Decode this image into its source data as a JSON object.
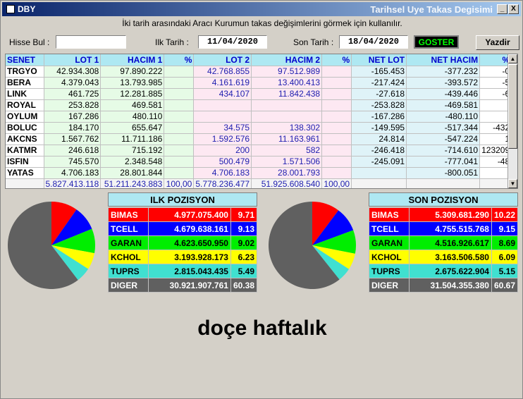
{
  "window": {
    "title": "DBY",
    "subtitle": "Tarihsel Uye Takas Degisimi",
    "min_label": "_",
    "close_label": "X"
  },
  "info_text": "İki tarih arasındaki Aracı Kurumun takas değişimlerini görmek için kullanılır.",
  "controls": {
    "hisse_label": "Hisse Bul :",
    "hisse_value": "",
    "ilk_label": "Ilk Tarih :",
    "ilk_value": "11/04/2020",
    "son_label": "Son Tarih :",
    "son_value": "18/04/2020",
    "goster_label": "GOSTER",
    "yazdir_label": "Yazdir"
  },
  "table": {
    "headers": [
      "SENET",
      "LOT 1",
      "HACIM 1",
      "%",
      "LOT 2",
      "HACIM 2",
      "%",
      "NET LOT",
      "NET HACIM",
      "%"
    ],
    "rows": [
      [
        "TRGYO",
        "42.934.308",
        "97.890.222",
        "",
        "42.768.855",
        "97.512.989",
        "",
        "-165.453",
        "-377.232",
        "-0"
      ],
      [
        "BERA",
        "4.379.043",
        "13.793.985",
        "",
        "4.161.619",
        "13.400.413",
        "",
        "-217.424",
        "-393.572",
        "-5"
      ],
      [
        "LINK",
        "461.725",
        "12.281.885",
        "",
        "434.107",
        "11.842.438",
        "",
        "-27.618",
        "-439.446",
        "-6"
      ],
      [
        "ROYAL",
        "253.828",
        "469.581",
        "",
        "",
        "",
        "",
        "-253.828",
        "-469.581",
        ""
      ],
      [
        "OYLUM",
        "167.286",
        "480.110",
        "",
        "",
        "",
        "",
        "-167.286",
        "-480.110",
        ""
      ],
      [
        "BOLUC",
        "184.170",
        "655.647",
        "",
        "34.575",
        "138.302",
        "",
        "-149.595",
        "-517.344",
        "-432"
      ],
      [
        "AKCNS",
        "1.567.762",
        "11.711.186",
        "",
        "1.592.576",
        "11.163.961",
        "",
        "24.814",
        "-547.224",
        "1"
      ],
      [
        "KATMR",
        "246.618",
        "715.192",
        "",
        "200",
        "582",
        "",
        "-246.418",
        "-714.610",
        "123209"
      ],
      [
        "ISFIN",
        "745.570",
        "2.348.548",
        "",
        "500.479",
        "1.571.506",
        "",
        "-245.091",
        "-777.041",
        "-48"
      ],
      [
        "YATAS",
        "4.706.183",
        "28.801.844",
        "",
        "4.706.183",
        "28.001.793",
        "",
        "",
        "-800.051",
        ""
      ]
    ],
    "totals": [
      "",
      "5.827.413.118",
      "51.211.243.883",
      "100,00",
      "5.778.236.477",
      "51.925.608.540",
      "100,00",
      "",
      "",
      ""
    ]
  },
  "ilk_pozisyon": {
    "title": "ILK POZISYON",
    "rows": [
      {
        "name": "BIMAS",
        "value": "4.977.075.400",
        "pct": "9.71",
        "color": "#ff0000",
        "text": "#ffffff"
      },
      {
        "name": "TCELL",
        "value": "4.679.638.161",
        "pct": "9.13",
        "color": "#0000ff",
        "text": "#ffffff"
      },
      {
        "name": "GARAN",
        "value": "4.623.650.950",
        "pct": "9.02",
        "color": "#00ee00",
        "text": "#000000"
      },
      {
        "name": "KCHOL",
        "value": "3.193.928.173",
        "pct": "6.23",
        "color": "#ffff00",
        "text": "#000000"
      },
      {
        "name": "TUPRS",
        "value": "2.815.043.435",
        "pct": "5.49",
        "color": "#40e0d0",
        "text": "#000000"
      },
      {
        "name": "DIGER",
        "value": "30.921.907.761",
        "pct": "60.38",
        "color": "#606060",
        "text": "#ffffff"
      }
    ]
  },
  "son_pozisyon": {
    "title": "SON POZISYON",
    "rows": [
      {
        "name": "BIMAS",
        "value": "5.309.681.290",
        "pct": "10.22",
        "color": "#ff0000",
        "text": "#ffffff"
      },
      {
        "name": "TCELL",
        "value": "4.755.515.768",
        "pct": "9.15",
        "color": "#0000ff",
        "text": "#ffffff"
      },
      {
        "name": "GARAN",
        "value": "4.516.926.617",
        "pct": "8.69",
        "color": "#00ee00",
        "text": "#000000"
      },
      {
        "name": "KCHOL",
        "value": "3.163.506.580",
        "pct": "6.09",
        "color": "#ffff00",
        "text": "#000000"
      },
      {
        "name": "TUPRS",
        "value": "2.675.622.904",
        "pct": "5.15",
        "color": "#40e0d0",
        "text": "#000000"
      },
      {
        "name": "DIGER",
        "value": "31.504.355.380",
        "pct": "60.67",
        "color": "#606060",
        "text": "#ffffff"
      }
    ]
  },
  "bottom_text": "doçe haftalık"
}
